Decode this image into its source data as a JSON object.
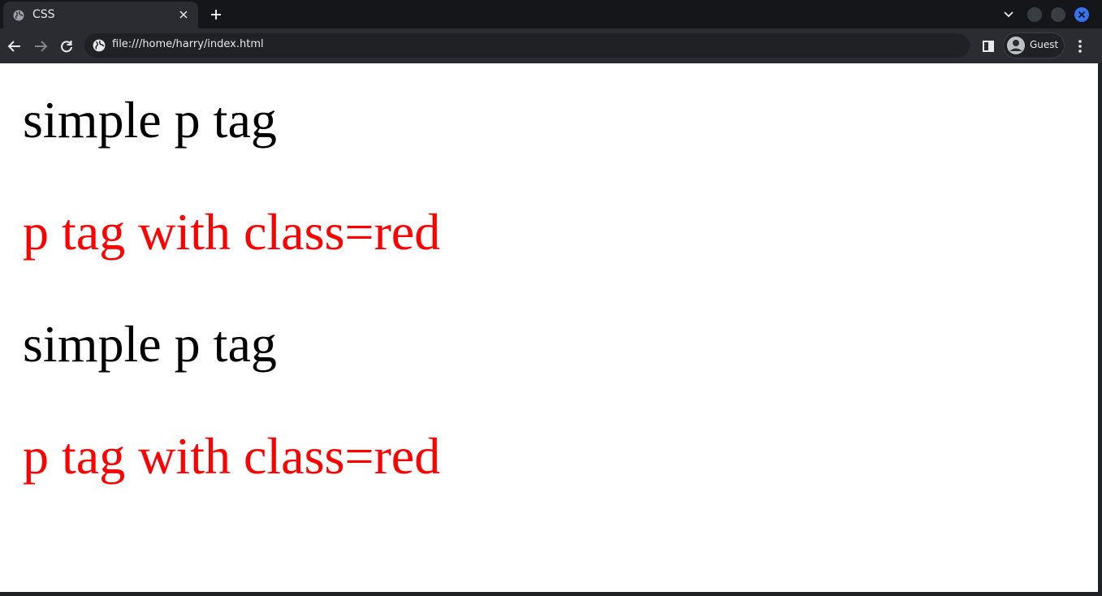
{
  "tab": {
    "title": "CSS"
  },
  "toolbar": {
    "url": "file:///home/harry/index.html",
    "profile_label": "Guest"
  },
  "page": {
    "paragraphs": [
      {
        "text": "simple p tag",
        "color": "#000000"
      },
      {
        "text": "p tag with class=red",
        "color": "#ff0000"
      },
      {
        "text": "simple p tag",
        "color": "#000000"
      },
      {
        "text": "p tag with class=red",
        "color": "#ff0000"
      }
    ]
  },
  "icons": {
    "tab_favicon": "globe-icon",
    "tab_close": "close-icon",
    "new_tab": "plus-icon",
    "tab_search": "chevron-down-icon",
    "back": "arrow-left-icon",
    "forward": "arrow-right-icon",
    "reload": "reload-icon",
    "site_info": "globe-icon",
    "side_panel": "side-panel-icon",
    "avatar": "avatar-icon",
    "menu": "kebab-menu-icon"
  },
  "colors": {
    "accent": "#3574f0",
    "red_text": "#ff0000"
  }
}
